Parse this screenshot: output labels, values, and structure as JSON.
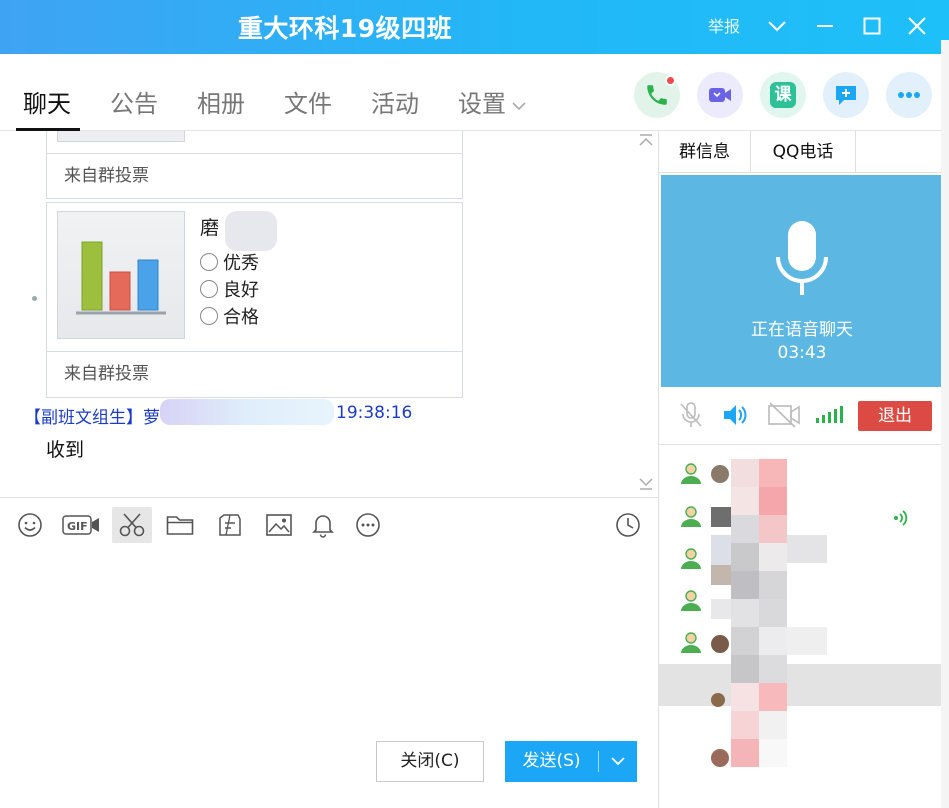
{
  "window": {
    "title": "重大环科19级四班",
    "report_label": "举报"
  },
  "tabs": [
    {
      "label": "聊天",
      "active": true
    },
    {
      "label": "公告",
      "active": false
    },
    {
      "label": "相册",
      "active": false
    },
    {
      "label": "文件",
      "active": false
    },
    {
      "label": "活动",
      "active": false
    },
    {
      "label": "设置",
      "active": false
    }
  ],
  "header_actions": [
    "phone-icon",
    "video-call-icon",
    "lesson-icon",
    "add-message-icon",
    "more-icon"
  ],
  "lesson_label": "课",
  "chat": {
    "poll_source_top": "来自群投票",
    "poll": {
      "title_visible": "磨",
      "options": [
        "优秀",
        "良好",
        "合格"
      ],
      "source": "来自群投票"
    },
    "message": {
      "sender": "【副班文组生】",
      "sender_name_visible": "萝",
      "time": "19:38:16",
      "text": "收到"
    }
  },
  "toolbar": [
    "emoji-icon",
    "gif-icon",
    "scissors-icon",
    "folder-icon",
    "mini-app-icon",
    "image-icon",
    "bell-icon",
    "more-circle-icon",
    "history-clock-icon"
  ],
  "gif_label": "GIF",
  "buttons": {
    "close": "关闭(C)",
    "send": "发送(S)"
  },
  "side_panel": {
    "tabs": [
      "群信息",
      "QQ电话"
    ],
    "voice_status": "正在语音聊天",
    "voice_timer": "03:43",
    "exit_label": "退出",
    "colors": {
      "voice_bg": "#5cb8e2",
      "exit": "#dc4b43",
      "signal": "#2bb24c"
    }
  },
  "colors": {
    "titlebar": "#22b7f7",
    "accent": "#1ba7f5",
    "sender_blue": "#1b3cc9"
  }
}
